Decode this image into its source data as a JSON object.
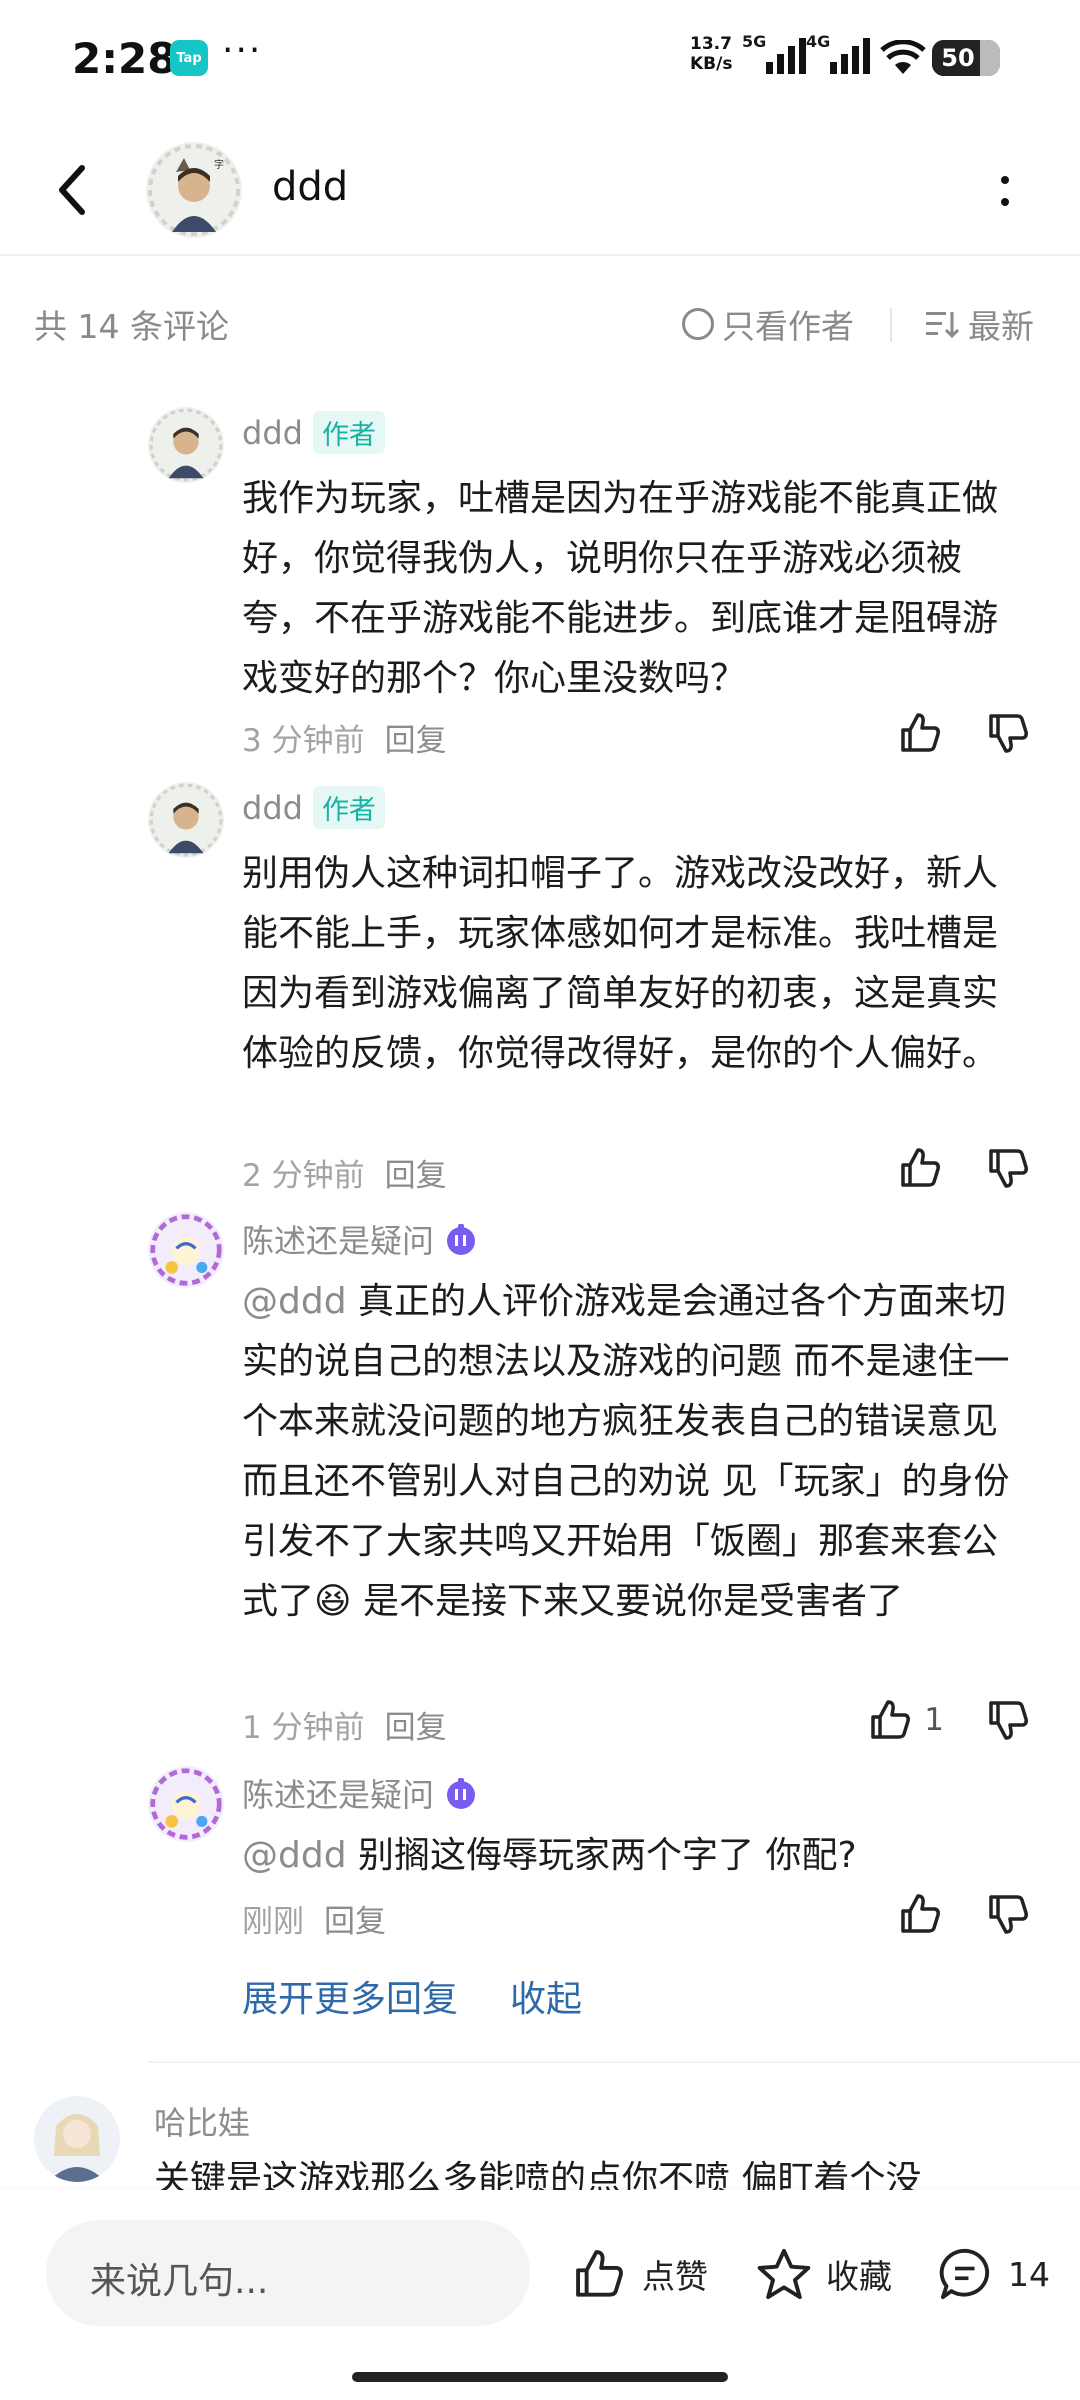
{
  "status_bar": {
    "time": "2:28",
    "app_badge": "Tap",
    "dots": "···",
    "net_speed_value": "13.7",
    "net_speed_unit": "KB/s",
    "sig1_label": "5G",
    "sig2_label": "4G",
    "battery": "50"
  },
  "header": {
    "title": "ddd"
  },
  "toolbar": {
    "count_text": "共 14 条评论",
    "only_author": "只看作者",
    "sort_label": "最新"
  },
  "replies": [
    {
      "name": "ddd",
      "tag": "作者",
      "text": "我作为玩家，吐槽是因为在乎游戏能不能真正做好，你觉得我伪人，说明你只在乎游戏必须被夸，不在乎游戏能不能进步。到底谁才是阻碍游戏变好的那个？你心里没数吗？",
      "time": "3 分钟前",
      "reply_label": "回复",
      "likes": ""
    },
    {
      "name": "ddd",
      "tag": "作者",
      "text": "别用伪人这种词扣帽子了。游戏改没改好，新人能不能上手，玩家体感如何才是标准。我吐槽是因为看到游戏偏离了简单友好的初衷，这是真实体验的反馈，你觉得改得好，是你的个人偏好。",
      "time": "2 分钟前",
      "reply_label": "回复",
      "likes": ""
    },
    {
      "name": "陈述还是疑问",
      "mention": "@ddd",
      "text": "真正的人评价游戏是会通过各个方面来切实的说自己的想法以及游戏的问题 而不是逮住一个本来就没问题的地方疯狂发表自己的错误意见 而且还不管别人对自己的劝说 见「玩家」的身份引发不了大家共鸣又开始用「饭圈」那套来套公式了😆 是不是接下来又要说你是受害者了",
      "time": "1 分钟前",
      "reply_label": "回复",
      "likes": "1"
    },
    {
      "name": "陈述还是疑问",
      "mention": "@ddd",
      "text": "别搁这侮辱玩家两个字了 你配?",
      "time": "刚刚",
      "reply_label": "回复",
      "likes": ""
    }
  ],
  "expand_label": "展开更多回复",
  "collapse_label": "收起",
  "next_comment": {
    "name": "哈比娃",
    "text": "关键是这游戏那么多能喷的点你不喷 偏盯着个没"
  },
  "bottom_bar": {
    "input_placeholder": "来说几句...",
    "like_label": "点赞",
    "fav_label": "收藏",
    "comment_count": "14"
  },
  "colors": {
    "author_tag_bg": "#e6f8f6",
    "author_tag_fg": "#17b3a2",
    "link": "#2f6aa8",
    "tap_badge": "#16c5c5",
    "level_badge": "#7b5cf0"
  },
  "icons": [
    "back-arrow-icon",
    "more-vertical-icon",
    "circle-icon",
    "sort-icon",
    "thumb-up-icon",
    "thumb-down-icon",
    "level-badge-icon",
    "star-icon",
    "comment-bubble-icon"
  ]
}
